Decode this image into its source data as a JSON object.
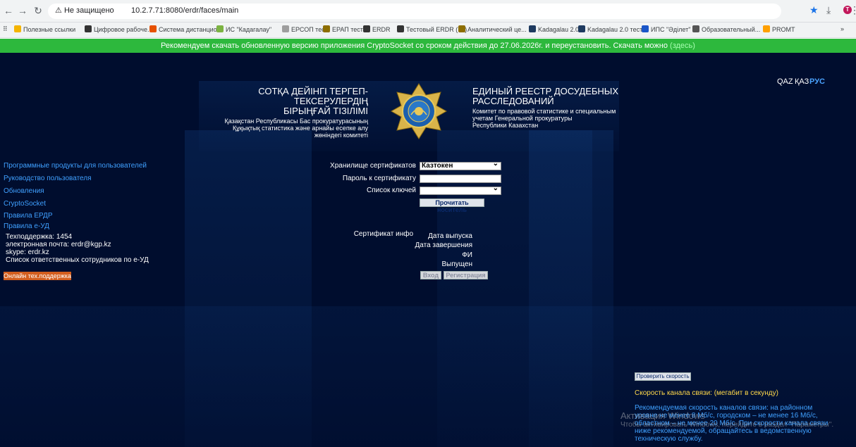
{
  "browser": {
    "security_label": "Не защищено",
    "url": "10.2.7.71:8080/erdr/faces/main",
    "bookmarks": [
      {
        "label": "Полезные ссылки",
        "color": "#f4b400"
      },
      {
        "label": "Цифровое рабоче...",
        "color": "#333333"
      },
      {
        "label": "Система дистанцио...",
        "color": "#e65100"
      },
      {
        "label": "ИС \"Кадагалау\"",
        "color": "#7cb342"
      },
      {
        "label": "ЕРСОП тест",
        "color": "#9e9e9e"
      },
      {
        "label": "ЕРАП тест",
        "color": "#8d6e00"
      },
      {
        "label": "ERDR",
        "color": "#333333"
      },
      {
        "label": "Тестовый ERDR (71)",
        "color": "#333333"
      },
      {
        "label": "Аналитический це...",
        "color": "#8d6e00"
      },
      {
        "label": "Kadagalau 2.0",
        "color": "#1e3a5f"
      },
      {
        "label": "Kadagalau 2.0 тест",
        "color": "#1e3a5f"
      },
      {
        "label": "ИПС \"Әділет\"",
        "color": "#1a56c8"
      },
      {
        "label": "Образовательный...",
        "color": "#555555"
      },
      {
        "label": "PROMT",
        "color": "#ffa000"
      }
    ],
    "more_label": "»",
    "profile_initial": "T"
  },
  "banner": {
    "text": "Рекомендуем скачать обновленную версию приложения CryptoSocket со сроком действия до 27.06.2026г. и переустановить. Скачать можно",
    "link": "(здесь)"
  },
  "languages": [
    "QAZ",
    "ҚАЗ",
    "РУС"
  ],
  "header": {
    "kz_title_1": "СОТҚА ДЕЙІНГІ ТЕРГЕП-ТЕКСЕРУЛЕРДІҢ",
    "kz_title_2": "БІРЫҢҒАЙ ТІЗІЛІМІ",
    "kz_sub_1": "Қазақстан Республикасы Бас прокуратурасының",
    "kz_sub_2": "Құқықтық статистика және арнайы есепке алу",
    "kz_sub_3": "жөніндегі комитеті",
    "ru_title_1": "ЕДИНЫЙ РЕЕСТР ДОСУДЕБНЫХ",
    "ru_title_2": "РАССЛЕДОВАНИЙ",
    "ru_sub_1": "Комитет по правовой статистике и специальным",
    "ru_sub_2": "учетам Генеральной прокуратуры",
    "ru_sub_3": "Республики Казахстан"
  },
  "left_links": [
    "Программные продукты для пользователей",
    "Руководство пользователя",
    "Обновления",
    "CryptoSocket",
    "Правила ЕРДР",
    "Правила е-УД"
  ],
  "contacts": {
    "support": "Техподдержка: 1454",
    "email": "электронная почта: erdr@kgp.kz",
    "skype": "skype: erdr.kz",
    "staff_list": "Список ответственных сотрудников по е-УД",
    "online_button": "Онлайн тех.поддержка"
  },
  "form": {
    "store_label": "Хранилище сертификатов",
    "store_value": "Казтокен",
    "password_label": "Пароль к сертификату",
    "password_value": "",
    "keys_label": "Список ключей",
    "keys_value": "",
    "read_button": "Прочитать носитель"
  },
  "certificate": {
    "info_label": "Сертификат инфо",
    "issue_date": "Дата выпуска",
    "end_date": "Дата завершения",
    "fio": "ФИ",
    "issued": "Выпущен",
    "login_button": "Вход",
    "register_button": "Регистрация"
  },
  "speed": {
    "check_button": "Проверить скорость",
    "label": "Скорость канала связи:  (мегабит в секунду)",
    "note": "Рекомендуемая скорость каналов связи: на районном уровне не менее 8 Мб/с, городском – не менее 16 Мб/с, областном – не менее 20 Мб/с. При скорости канала связи ниже рекомендуемой, обращайтесь в ведомственную техническую службу."
  },
  "watermark": {
    "title": "Активация Windows",
    "text": "Чтобы активировать Windows, перейдите в раздел \"Параметры\"."
  }
}
